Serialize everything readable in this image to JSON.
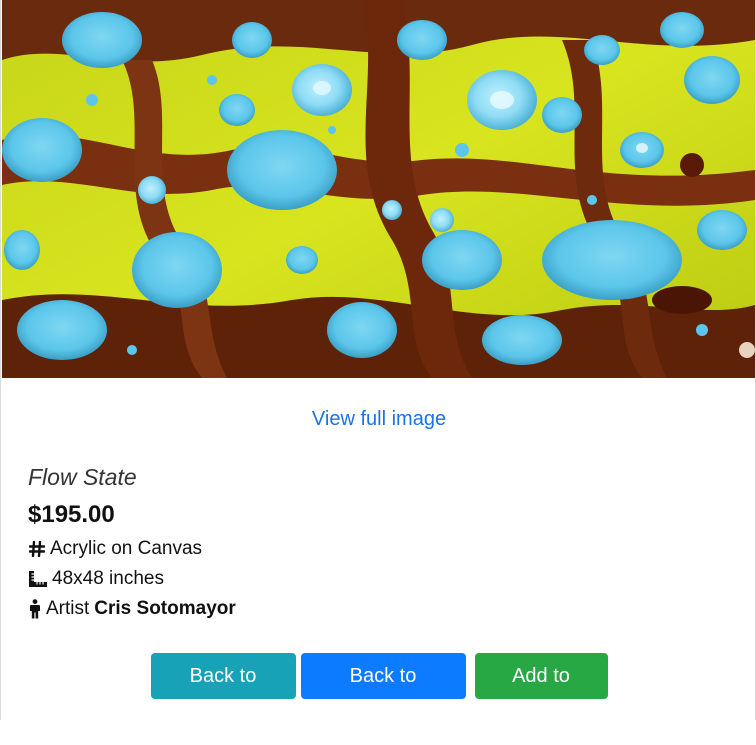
{
  "image": {
    "alt_subject": "fluid acrylic pour painting with blue cells on yellow-green and brown"
  },
  "links": {
    "view_full_image": "View full image"
  },
  "product": {
    "title": "Flow State",
    "price": "$195.00",
    "medium": "Acrylic on Canvas",
    "size": "48x48 inches",
    "artist_label": "Artist",
    "artist_name": "Cris Sotomayor"
  },
  "icons": {
    "medium": "hash-icon",
    "size": "ruler-icon",
    "artist": "person-icon"
  },
  "actions": {
    "back_to_shop": "Back to Shop",
    "back_to_gallery": "Back to Gallery",
    "add_to_cart": "Add to Cart"
  },
  "colors": {
    "link": "#1a73e8",
    "shop_button": "#17a2b8",
    "gallery_button": "#0d7bff",
    "cart_button": "#28a745"
  }
}
